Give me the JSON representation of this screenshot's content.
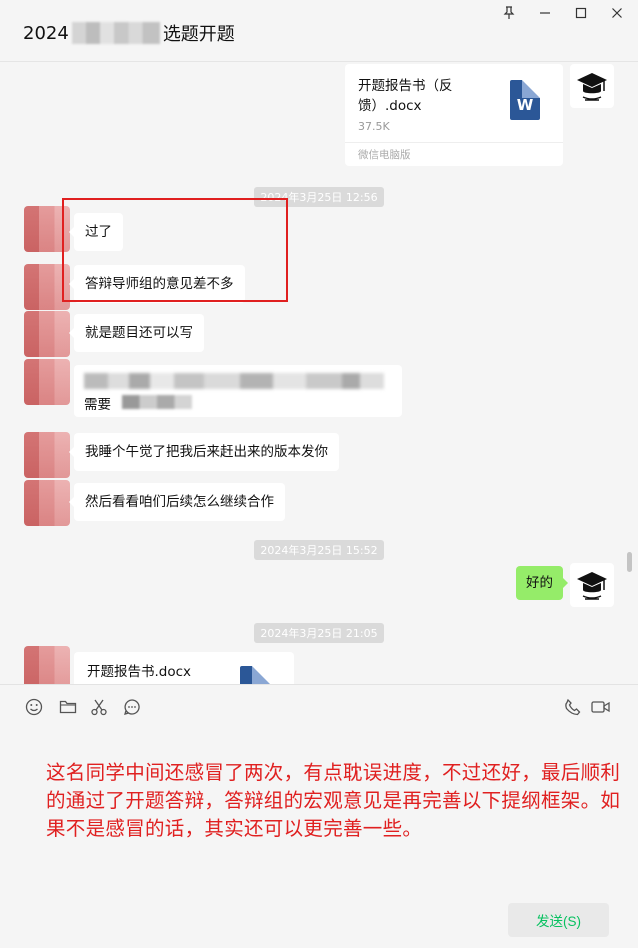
{
  "window": {
    "title_prefix": "2024",
    "title_suffix": "选题开题",
    "controls": [
      "pin",
      "minimize",
      "maximize",
      "close"
    ]
  },
  "messages": [
    {
      "type": "file",
      "side": "right",
      "filename": "开题报告书（反馈）.docx",
      "size": "37.5K",
      "source": "微信电脑版"
    },
    {
      "type": "timestamp",
      "text": "2024年3月25日 12:56"
    },
    {
      "type": "text",
      "side": "left",
      "text": "过了"
    },
    {
      "type": "text",
      "side": "left",
      "text": "答辩导师组的意见差不多"
    },
    {
      "type": "text",
      "side": "left",
      "text": "就是题目还可以写"
    },
    {
      "type": "text",
      "side": "left",
      "text_visible": "需要"
    },
    {
      "type": "text",
      "side": "left",
      "text": "我睡个午觉了把我后来赶出来的版本发你"
    },
    {
      "type": "text",
      "side": "left",
      "text": "然后看看咱们后续怎么继续合作"
    },
    {
      "type": "timestamp",
      "text": "2024年3月25日 15:52"
    },
    {
      "type": "text",
      "side": "right",
      "text": "好的"
    },
    {
      "type": "timestamp",
      "text": "2024年3月25日 21:05"
    },
    {
      "type": "file",
      "side": "left",
      "filename": "开题报告书.docx"
    }
  ],
  "toolbar": {
    "icons": [
      "emoji-icon",
      "folder-icon",
      "scissors-icon",
      "chat-history-icon",
      "phone-icon",
      "video-icon"
    ]
  },
  "input": {
    "text": "这名同学中间还感冒了两次，有点耽误进度，不过还好，最后顺利的通过了开题答辩，答辩组的宏观意见是再完善以下提纲框架。如果不是感冒的话，其实还可以更完善一些。"
  },
  "send_button": {
    "label": "发送(S)"
  },
  "colors": {
    "highlight_box": "#e02020",
    "input_text": "#e02020",
    "self_bubble": "#95ec69",
    "send_text": "#07c160",
    "doc_icon": "#2b5797"
  }
}
